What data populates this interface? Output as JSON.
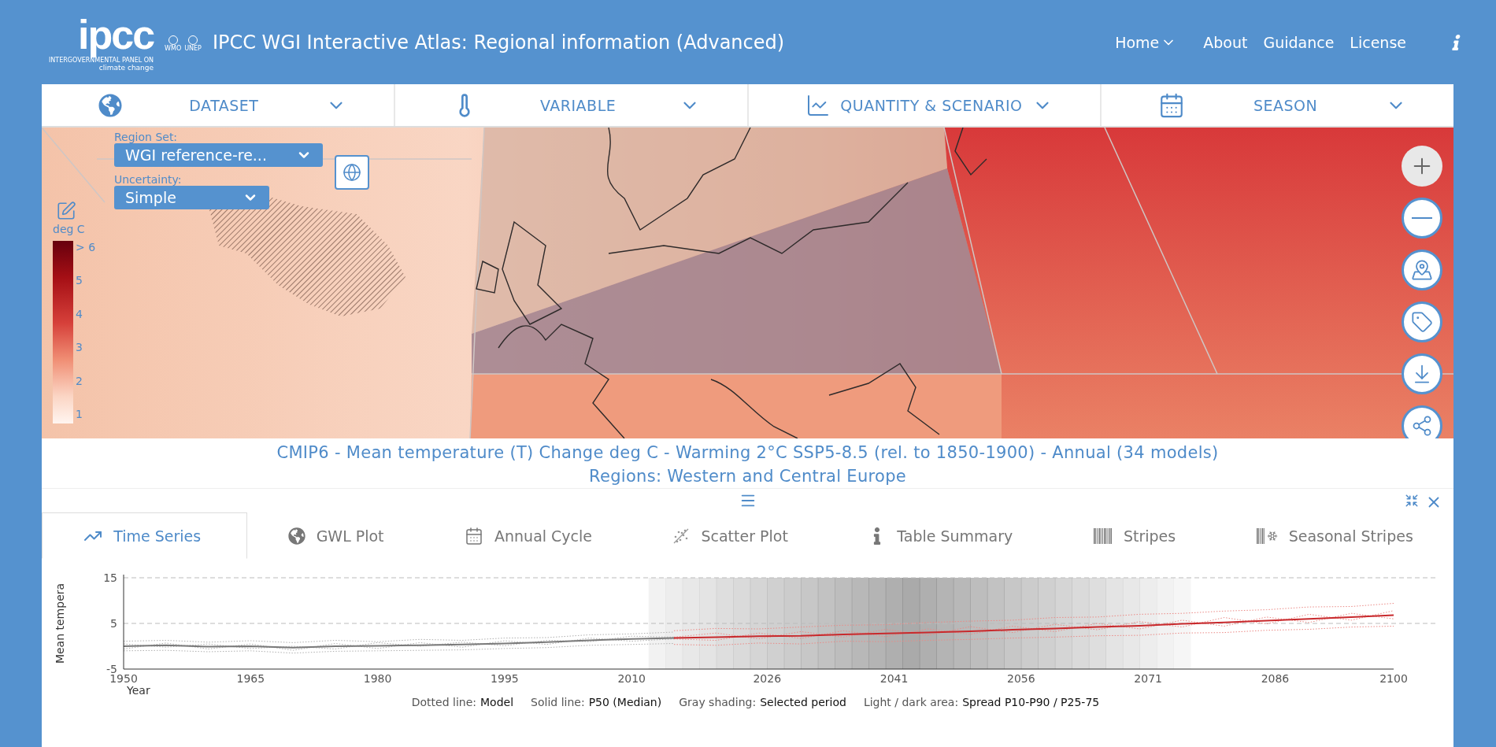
{
  "header": {
    "logo": {
      "wordmark": "ipcc",
      "line_1": "INTERGOVERNMENTAL PANEL ON",
      "line_2": "climate change",
      "partners": [
        "WMO",
        "UNEP"
      ]
    },
    "title": "IPCC WGI Interactive Atlas: Regional information (Advanced)",
    "nav": [
      {
        "label": "Home",
        "kind": "dropdown"
      },
      {
        "label": "About",
        "kind": "link"
      },
      {
        "label": "Guidance",
        "kind": "link"
      },
      {
        "label": "License",
        "kind": "link"
      }
    ]
  },
  "selectors": [
    {
      "label": "DATASET"
    },
    {
      "label": "VARIABLE"
    },
    {
      "label": "QUANTITY & SCENARIO"
    },
    {
      "label": "SEASON"
    }
  ],
  "map": {
    "region_set": {
      "label": "Region Set:",
      "value": "WGI reference-re..."
    },
    "uncertainty": {
      "label": "Uncertainty:",
      "value": "Simple"
    },
    "scale": {
      "unit": "deg C",
      "ticks": [
        "> 6",
        "5",
        "4",
        "3",
        "2",
        "1"
      ]
    }
  },
  "map_title": [
    "CMIP6 - Mean temperature (T) Change deg C - Warming 2°C SSP5-8.5 (rel. to 1850-1900) - Annual (34 models)",
    "Regions: Western and Central Europe"
  ],
  "tabs": [
    {
      "label": "Time Series",
      "selected": true
    },
    {
      "label": "GWL Plot",
      "selected": false
    },
    {
      "label": "Annual Cycle",
      "selected": false
    },
    {
      "label": "Scatter Plot",
      "selected": false
    },
    {
      "label": "Table Summary",
      "selected": false
    },
    {
      "label": "Stripes",
      "selected": false
    },
    {
      "label": "Seasonal Stripes",
      "selected": false
    }
  ],
  "chart": {
    "chart_data": {
      "type": "line",
      "xlabel": "Year",
      "ylabel": "Mean tempera",
      "x": [
        1950,
        1955,
        1960,
        1965,
        1970,
        1975,
        1980,
        1985,
        1990,
        1995,
        2000,
        2005,
        2010,
        2015,
        2020,
        2025,
        2030,
        2035,
        2040,
        2045,
        2050,
        2055,
        2060,
        2065,
        2070,
        2075,
        2080,
        2085,
        2090,
        2095,
        2100
      ],
      "series": [
        {
          "line_style": "dotted",
          "color": "#b0b0b0",
          "values": [
            1.1,
            1.3,
            0.9,
            1.2,
            0.8,
            1.3,
            1.0,
            1.5,
            1.3,
            1.8,
            1.9,
            2.5,
            2.7,
            3.1,
            null,
            null,
            null,
            null,
            null,
            null,
            null,
            null,
            null,
            null,
            null,
            null,
            null,
            null,
            null,
            null,
            null
          ]
        },
        {
          "line_style": "dotted",
          "color": "#b0b0b0",
          "values": [
            -1.0,
            -0.9,
            -1.2,
            -1.0,
            -1.5,
            -1.1,
            -1.0,
            -0.9,
            -0.8,
            -0.5,
            -0.3,
            0.2,
            0.4,
            0.6,
            null,
            null,
            null,
            null,
            null,
            null,
            null,
            null,
            null,
            null,
            null,
            null,
            null,
            null,
            null,
            null,
            null
          ]
        },
        {
          "line_style": "dotted",
          "color": "#ec8a86",
          "values": [
            null,
            null,
            null,
            null,
            null,
            null,
            null,
            null,
            null,
            null,
            null,
            null,
            null,
            3.4,
            3.9,
            3.8,
            4.2,
            4.6,
            4.7,
            5.2,
            5.5,
            5.7,
            6.3,
            6.4,
            7.0,
            7.2,
            7.7,
            8.0,
            8.6,
            8.7,
            9.4
          ]
        },
        {
          "line_style": "dotted",
          "color": "#ec8a86",
          "values": [
            null,
            null,
            null,
            null,
            null,
            null,
            null,
            null,
            null,
            null,
            null,
            null,
            null,
            0.4,
            0.2,
            0.7,
            0.5,
            1.1,
            1.0,
            1.3,
            1.5,
            1.8,
            2.0,
            2.3,
            2.4,
            2.9,
            3.0,
            3.5,
            3.7,
            4.2,
            4.4
          ]
        },
        {
          "line_style": "dotted",
          "color": "#b0b0b0",
          "values": [
            0.5,
            -0.2,
            0.5,
            -0.5,
            0,
            -0.6,
            0.8,
            0,
            0.9,
            0.1,
            1.3,
            1.0,
            2.2,
            2.0,
            null,
            null,
            null,
            null,
            null,
            null,
            null,
            null,
            null,
            null,
            null,
            null,
            null,
            null,
            null,
            null,
            null
          ]
        },
        {
          "line_style": "dotted",
          "color": "#b0b0b0",
          "values": [
            -0.6,
            0.7,
            -0.6,
            0.5,
            -0.9,
            0.6,
            -0.5,
            0.8,
            -0.2,
            1.2,
            0.4,
            1.8,
            1.1,
            1.6,
            null,
            null,
            null,
            null,
            null,
            null,
            null,
            null,
            null,
            null,
            null,
            null,
            null,
            null,
            null,
            null,
            null
          ]
        },
        {
          "line_style": "dotted",
          "color": "#ec8a86",
          "values": [
            null,
            null,
            null,
            null,
            null,
            null,
            null,
            null,
            null,
            null,
            null,
            null,
            null,
            2.0,
            2.9,
            1.6,
            3.2,
            2.0,
            3.7,
            2.4,
            4.3,
            3.0,
            4.8,
            3.6,
            5.4,
            4.2,
            6.3,
            4.9,
            7.0,
            5.7,
            7.8
          ]
        },
        {
          "line_style": "dotted",
          "color": "#ec8a86",
          "values": [
            null,
            null,
            null,
            null,
            null,
            null,
            null,
            null,
            null,
            null,
            null,
            null,
            null,
            1.6,
            1.3,
            2.9,
            1.7,
            3.4,
            2.1,
            3.8,
            2.6,
            4.4,
            3.2,
            5.0,
            3.8,
            5.7,
            4.4,
            6.4,
            5.2,
            7.2,
            6.0
          ]
        },
        {
          "line_style": "solid",
          "color": "#7a7a7a",
          "values": [
            0,
            0.2,
            -0.1,
            0,
            -0.3,
            0,
            0.1,
            0.2,
            0.4,
            0.6,
            0.9,
            1.3,
            1.6,
            1.8,
            null,
            null,
            null,
            null,
            null,
            null,
            null,
            null,
            null,
            null,
            null,
            null,
            null,
            null,
            null,
            null,
            null
          ]
        },
        {
          "line_style": "solid",
          "color": "#c8292c",
          "values": [
            null,
            null,
            null,
            null,
            null,
            null,
            null,
            null,
            null,
            null,
            null,
            null,
            null,
            1.8,
            2.0,
            2.2,
            2.3,
            2.6,
            2.8,
            3.0,
            3.3,
            3.6,
            3.9,
            4.2,
            4.5,
            4.9,
            5.2,
            5.6,
            6.0,
            6.4,
            6.8
          ]
        }
      ],
      "xlim": [
        1950,
        2100
      ],
      "ylim": [
        -5,
        15
      ],
      "xticks": [
        1950,
        1965,
        1980,
        1995,
        2010,
        2026,
        2041,
        2056,
        2071,
        2086,
        2100
      ],
      "yticks": [
        -5,
        5,
        15
      ]
    }
  },
  "chart_legend": [
    {
      "label": "Dotted line:",
      "value": "Model"
    },
    {
      "label": "Solid line:",
      "value": "P50 (Median)"
    },
    {
      "label": "Gray shading:",
      "value": "Selected period"
    },
    {
      "label": "Light / dark area:",
      "value": "Spread P10-P90 / P25-75"
    }
  ]
}
